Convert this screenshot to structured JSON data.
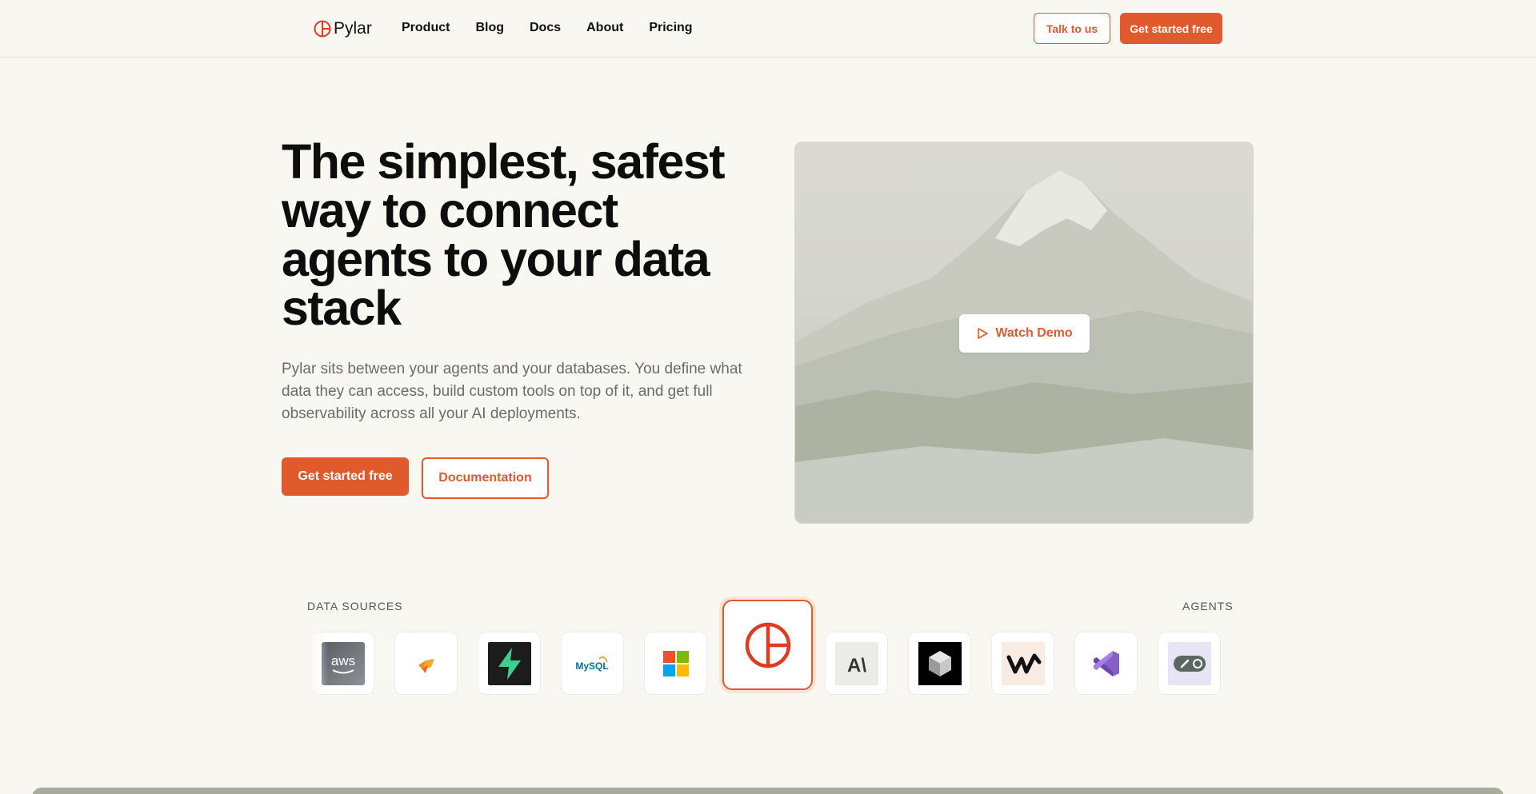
{
  "brand": {
    "name": "Pylar",
    "accent": "#e05a2b"
  },
  "nav": {
    "links": [
      "Product",
      "Blog",
      "Docs",
      "About",
      "Pricing"
    ],
    "talk_label": "Talk to us",
    "cta_label": "Get started free"
  },
  "hero": {
    "title": "The simplest, safest way to connect agents to your data stack",
    "subtitle": "Pylar sits between your agents and your databases. You define what data they can access, build custom tools on top of it, and get full observability across all your AI deployments.",
    "primary_label": "Get started free",
    "secondary_label": "Documentation",
    "demo_label": "Watch Demo"
  },
  "integrations": {
    "sources_label": "DATA SOURCES",
    "agents_label": "AGENTS",
    "sources": [
      "aws-icon",
      "orange-bird-icon",
      "supabase-icon",
      "mysql-icon",
      "microsoft-icon"
    ],
    "agents": [
      "anthropic-icon",
      "cube-icon",
      "windsurf-icon",
      "visual-studio-icon",
      "link-toggle-icon"
    ],
    "aws_text": "aws",
    "mysql_text": "MySQL",
    "anthropic_text": "A\\"
  }
}
